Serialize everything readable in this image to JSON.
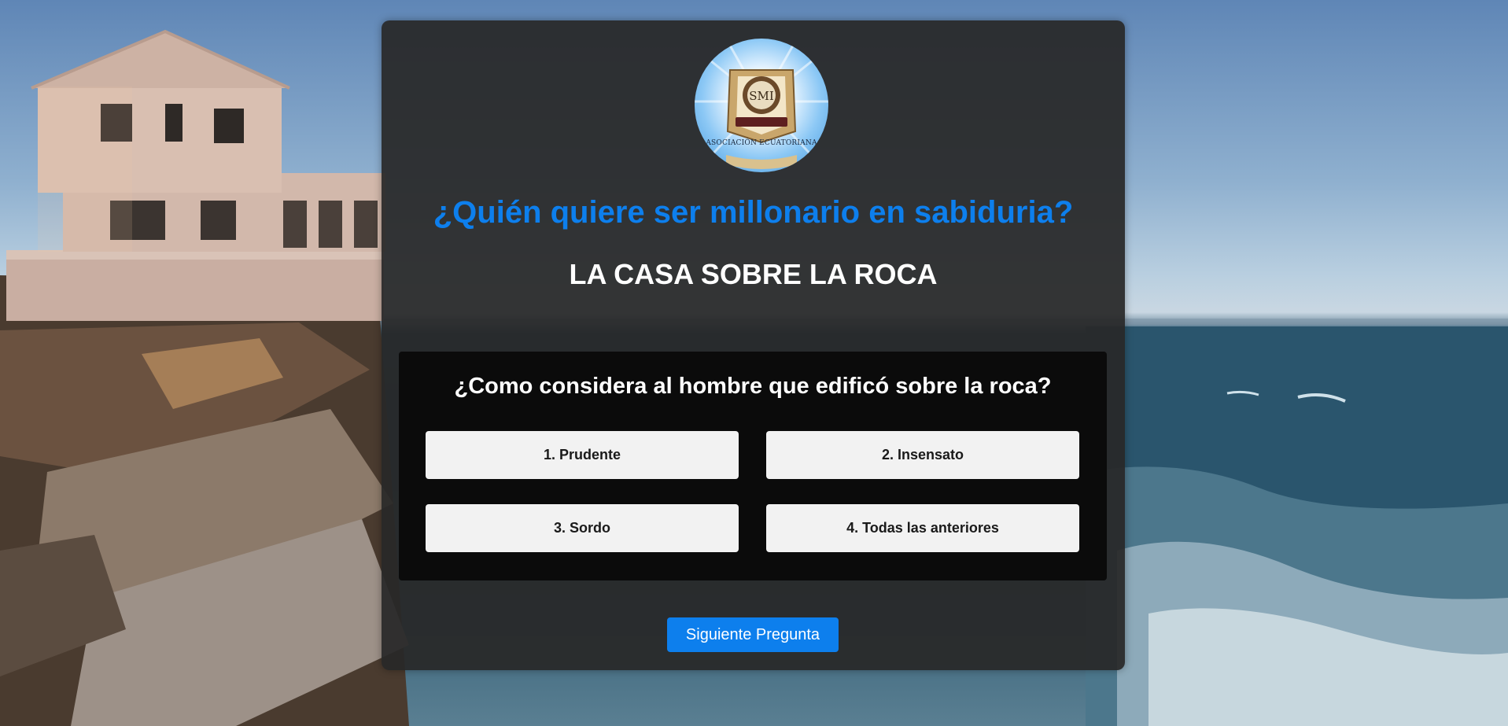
{
  "header": {
    "logo_icon": "asociacion-ecuatoriana-logo",
    "logo_letters": "SMI",
    "logo_caption": "ASOCIACIÓN ECUATORIANA",
    "title": "¿Quién quiere ser millonario en sabiduria?",
    "subtitle": "LA CASA SOBRE LA ROCA"
  },
  "question": {
    "text": "¿Como considera al hombre que edificó sobre la roca?",
    "answers": [
      {
        "label": "1. Prudente"
      },
      {
        "label": "2. Insensato"
      },
      {
        "label": "3. Sordo"
      },
      {
        "label": "4. Todas las anteriores"
      }
    ]
  },
  "footer": {
    "next_label": "Siguiente Pregunta"
  },
  "colors": {
    "accent": "#0d7fed",
    "panel": "#282828",
    "question_box": "#0b0b0b",
    "answer_bg": "#f2f2f2"
  }
}
